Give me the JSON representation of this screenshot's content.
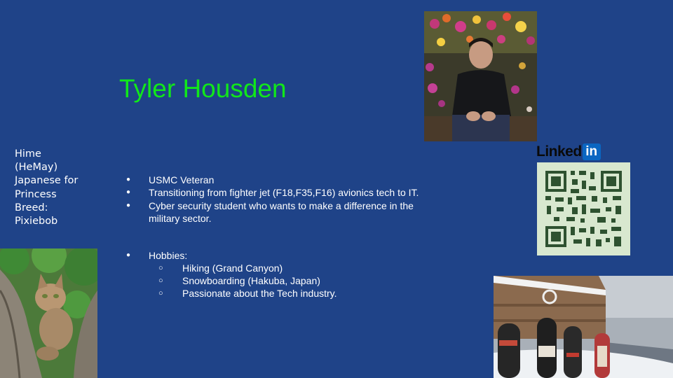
{
  "slide": {
    "title": "Tyler Housden",
    "cat_caption": [
      "Hime",
      "(HeMay)",
      "Japanese for",
      "Princess",
      "Breed:",
      "Pixiebob"
    ],
    "bullets": [
      "USMC Veteran",
      "Transitioning from fighter jet (F18,F35,F16) avionics tech to IT.",
      "Cyber security student who wants to make a difference in the military sector."
    ],
    "hobbies": {
      "label": "Hobbies:",
      "items": [
        "Hiking (Grand Canyon)",
        "Snowboarding (Hakuba, Japan)",
        "Passionate about the Tech industry."
      ]
    },
    "linkedin": {
      "text": "Linked",
      "box": "in"
    },
    "colors": {
      "background": "#1f4388",
      "title": "#11e81a",
      "text": "#ffffff",
      "qr": "#2e5230",
      "qr_bg": "#d8e8cf"
    },
    "images": [
      "portrait-photo",
      "cat-photo",
      "qr-code",
      "snowboards-photo"
    ]
  }
}
